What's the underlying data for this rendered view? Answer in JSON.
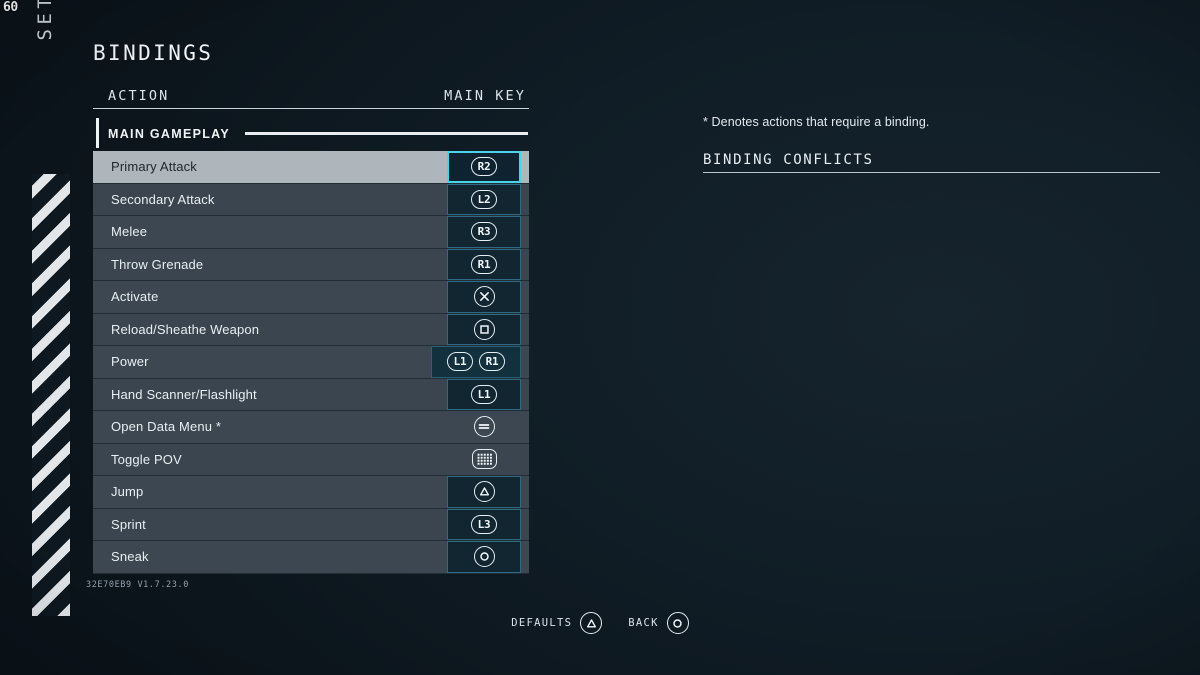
{
  "hud": {
    "fps": "60"
  },
  "rail": {
    "section_label": "SETTINGS",
    "hazard_icon": "diagonal-stripe-pattern"
  },
  "header": {
    "title": "BINDINGS"
  },
  "table": {
    "columns": {
      "action": "ACTION",
      "main_key": "MAIN KEY"
    },
    "section": {
      "label": "MAIN GAMEPLAY"
    },
    "rows": [
      {
        "action": "Primary Attack",
        "selected": true,
        "framed": true,
        "keys": [
          {
            "icon": "r2-button-icon",
            "label": "R2"
          }
        ]
      },
      {
        "action": "Secondary Attack",
        "selected": false,
        "framed": true,
        "keys": [
          {
            "icon": "l2-button-icon",
            "label": "L2"
          }
        ]
      },
      {
        "action": "Melee",
        "selected": false,
        "framed": true,
        "keys": [
          {
            "icon": "r3-button-icon",
            "label": "R3"
          }
        ]
      },
      {
        "action": "Throw Grenade",
        "selected": false,
        "framed": true,
        "keys": [
          {
            "icon": "r1-button-icon",
            "label": "R1"
          }
        ]
      },
      {
        "action": "Activate",
        "selected": false,
        "framed": true,
        "keys": [
          {
            "icon": "cross-button-icon",
            "label": ""
          }
        ]
      },
      {
        "action": "Reload/Sheathe Weapon",
        "selected": false,
        "framed": true,
        "keys": [
          {
            "icon": "square-button-icon",
            "label": ""
          }
        ]
      },
      {
        "action": "Power",
        "selected": false,
        "framed": true,
        "keys": [
          {
            "icon": "l1-button-icon",
            "label": "L1"
          },
          {
            "icon": "r1-button-icon",
            "label": "R1"
          }
        ]
      },
      {
        "action": "Hand Scanner/Flashlight",
        "selected": false,
        "framed": true,
        "keys": [
          {
            "icon": "l1-button-icon",
            "label": "L1"
          }
        ]
      },
      {
        "action": "Open Data Menu *",
        "selected": false,
        "framed": false,
        "keys": [
          {
            "icon": "options-button-icon",
            "label": ""
          }
        ]
      },
      {
        "action": "Toggle POV",
        "selected": false,
        "framed": false,
        "keys": [
          {
            "icon": "touchpad-button-icon",
            "label": ""
          }
        ]
      },
      {
        "action": "Jump",
        "selected": false,
        "framed": true,
        "keys": [
          {
            "icon": "triangle-button-icon",
            "label": ""
          }
        ]
      },
      {
        "action": "Sprint",
        "selected": false,
        "framed": true,
        "keys": [
          {
            "icon": "l3-button-icon",
            "label": "L3"
          }
        ]
      },
      {
        "action": "Sneak",
        "selected": false,
        "framed": true,
        "keys": [
          {
            "icon": "circle-button-icon",
            "label": ""
          }
        ]
      }
    ]
  },
  "build_stamp": "32E70EB9 V1.7.23.0",
  "right_panel": {
    "denotes_note": "* Denotes actions that require a binding.",
    "conflicts_title": "BINDING CONFLICTS"
  },
  "footer": {
    "buttons": [
      {
        "label": "DEFAULTS",
        "icon": "triangle-button-icon"
      },
      {
        "label": "BACK",
        "icon": "circle-button-icon"
      }
    ]
  },
  "colors": {
    "background": "#0d1820",
    "row": "#3c4751",
    "row_selected": "#aeb6bc",
    "accent_cyan": "#49d4ea",
    "key_frame": "#2e6a84",
    "text": "#e8edf2"
  }
}
